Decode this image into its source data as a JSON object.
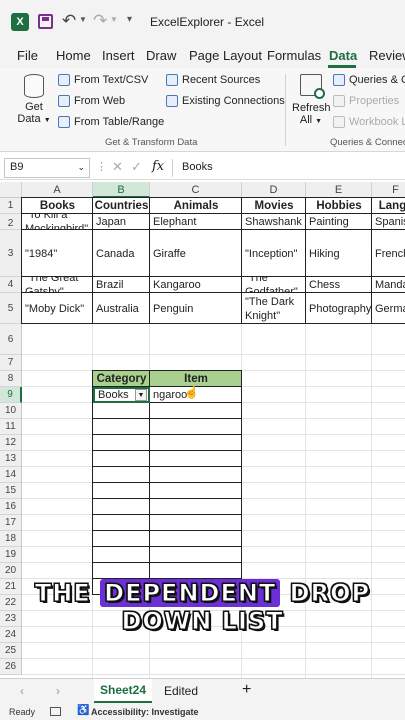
{
  "window": {
    "title": "ExcelExplorer",
    "app": "Excel",
    "separator": "-"
  },
  "menu": [
    "File",
    "Home",
    "Insert",
    "Draw",
    "Page Layout",
    "Formulas",
    "Data",
    "Review"
  ],
  "active_menu": "Data",
  "ribbon": {
    "get_data": "Get Data",
    "get_data_line1": "Get",
    "get_data_line2": "Data",
    "from_text_csv": "From Text/CSV",
    "from_web": "From Web",
    "from_table_range": "From Table/Range",
    "recent_sources": "Recent Sources",
    "existing_connections": "Existing Connections",
    "group_get_transform": "Get & Transform Data",
    "refresh_line1": "Refresh",
    "refresh_line2": "All",
    "queries_connections": "Queries & Co",
    "properties": "Properties",
    "workbook_links": "Workbook Li",
    "group_queries": "Queries & Connecti"
  },
  "formula_bar": {
    "name_box": "B9",
    "fx": "fx",
    "value": "Books"
  },
  "columns": [
    "A",
    "B",
    "C",
    "D",
    "E",
    "F"
  ],
  "rows": [
    "1",
    "2",
    "3",
    "4",
    "5",
    "6",
    "7",
    "8",
    "9",
    "10",
    "11",
    "12",
    "13",
    "14",
    "15",
    "16",
    "17",
    "18",
    "19",
    "20",
    "21",
    "22",
    "23",
    "24",
    "25",
    "26"
  ],
  "cells": {
    "A1": "Books",
    "B1": "Countries",
    "C1": "Animals",
    "D1": "Movies",
    "E1": "Hobbies",
    "F1": "Langu",
    "A2": "\"To Kill a Mockingbird\"",
    "B2": "Japan",
    "C2": "Elephant",
    "D2": "\"The Shawshank Redemption\"",
    "E2": "Painting",
    "F2": "Spanis",
    "A3": "\"1984\"",
    "B3": "Canada",
    "C3": "Giraffe",
    "D3": "\"Inception\"",
    "E3": "Hiking",
    "F3": "French",
    "A4": "\"The Great Gatsby\"",
    "B4": "Brazil",
    "C4": "Kangaroo",
    "D4": "\"The Godfather\"",
    "E4": "Chess",
    "F4": "Manda",
    "A5": "\"Moby Dick\"",
    "B5": "Australia",
    "C5": "Penguin",
    "D5": "\"The Dark Knight\"",
    "E5": "Photography",
    "F5": "Germa",
    "B8": "Category",
    "C8": "Item",
    "B9": "Books",
    "C9": "ngaroo"
  },
  "table_header_color": "#a9d08e",
  "sheet_tabs": {
    "active": "Sheet24",
    "other": "Edited",
    "add": "+"
  },
  "status": {
    "ready": "Ready",
    "accessibility": "Accessibility: Investigate"
  },
  "caption": {
    "line1_a": "THE ",
    "line1_highlight": "DEPENDENT",
    "line1_b": " DROP",
    "line2": "DOWN LIST"
  },
  "accent_color": "#1d6f42",
  "caption_highlight_color": "#6b2fd6"
}
